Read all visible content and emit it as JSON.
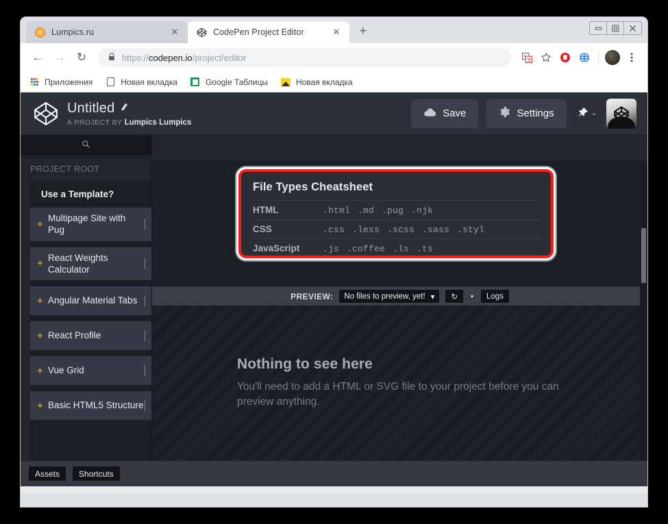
{
  "browser": {
    "tabs": [
      {
        "title": "Lumpics.ru",
        "favicon": "orange-circle-icon",
        "active": false
      },
      {
        "title": "CodePen Project Editor",
        "favicon": "codepen-logo-icon",
        "active": true
      }
    ],
    "new_tab_label": "+",
    "window_controls": {
      "minimize": "–",
      "maximize": "❐",
      "close": "✕"
    },
    "nav": {
      "back": "←",
      "forward": "→",
      "reload": "↻"
    },
    "omnibox": {
      "lock": "🔒",
      "url_scheme": "https://",
      "url_host": "codepen.io",
      "url_path": "/project/editor",
      "full_url": "https://codepen.io/project/editor"
    },
    "toolbar_icons": [
      "translate-icon",
      "bookmark-star-icon",
      "adblock-icon",
      "globe-icon",
      "profile-avatar",
      "chrome-menu-icon"
    ],
    "bookmarks": [
      {
        "label": "Приложения",
        "icon": "apps-grid-icon"
      },
      {
        "label": "Новая вкладка",
        "icon": "page-icon"
      },
      {
        "label": "Google Таблицы",
        "icon": "google-sheets-icon"
      },
      {
        "label": "Новая вкладка",
        "icon": "image-icon"
      }
    ]
  },
  "codepen": {
    "header": {
      "logo": "codepen-logo-icon",
      "project_title": "Untitled",
      "edit_icon": "pencil-icon",
      "byline_prefix": "A PROJECT BY",
      "byline_author": "Lumpics Lumpics",
      "save_label": "Save",
      "save_icon": "cloud-icon",
      "settings_label": "Settings",
      "settings_icon": "gear-icon",
      "pin_icon": "pin-icon",
      "pin_chevron": "⌄",
      "avatar": "user-avatar"
    },
    "sidebar": {
      "search_icon": "search-icon",
      "project_root_label": "PROJECT ROOT",
      "templates_title": "Use a Template?",
      "templates": [
        {
          "label": "Multipage Site with Pug",
          "add_icon": "+"
        },
        {
          "label": "React Weights Calculator",
          "add_icon": "+"
        },
        {
          "label": "Angular Material Tabs",
          "add_icon": "+"
        },
        {
          "label": "React Profile",
          "add_icon": "+"
        },
        {
          "label": "Vue Grid",
          "add_icon": "+"
        },
        {
          "label": "Basic HTML5 Structure",
          "add_icon": "+"
        }
      ]
    },
    "cheatsheet": {
      "title": "File Types Cheatsheet",
      "rows": [
        {
          "language": "HTML",
          "extensions": [
            ".html",
            ".md",
            ".pug",
            ".njk"
          ]
        },
        {
          "language": "CSS",
          "extensions": [
            ".css",
            ".less",
            ".scss",
            ".sass",
            ".styl"
          ]
        },
        {
          "language": "JavaScript",
          "extensions": [
            ".js",
            ".coffee",
            ".ls",
            ".ts"
          ]
        }
      ]
    },
    "preview_bar": {
      "label": "PREVIEW:",
      "selected_file": "No files to preview, yet!",
      "dropdown_caret": "▾",
      "refresh_icon": "↻",
      "dot_icon": "▪",
      "logs_label": "Logs"
    },
    "preview_empty": {
      "heading": "Nothing to see here",
      "body": "You'll need to add a HTML or SVG file to your project before you can preview anything."
    },
    "footer": {
      "assets_label": "Assets",
      "shortcuts_label": "Shortcuts"
    }
  },
  "colors": {
    "annotation_red": "#ff1a1a",
    "accent_yellow": "#f0c040",
    "app_bg": "#1d1f26",
    "panel_bg": "#2c303a"
  }
}
